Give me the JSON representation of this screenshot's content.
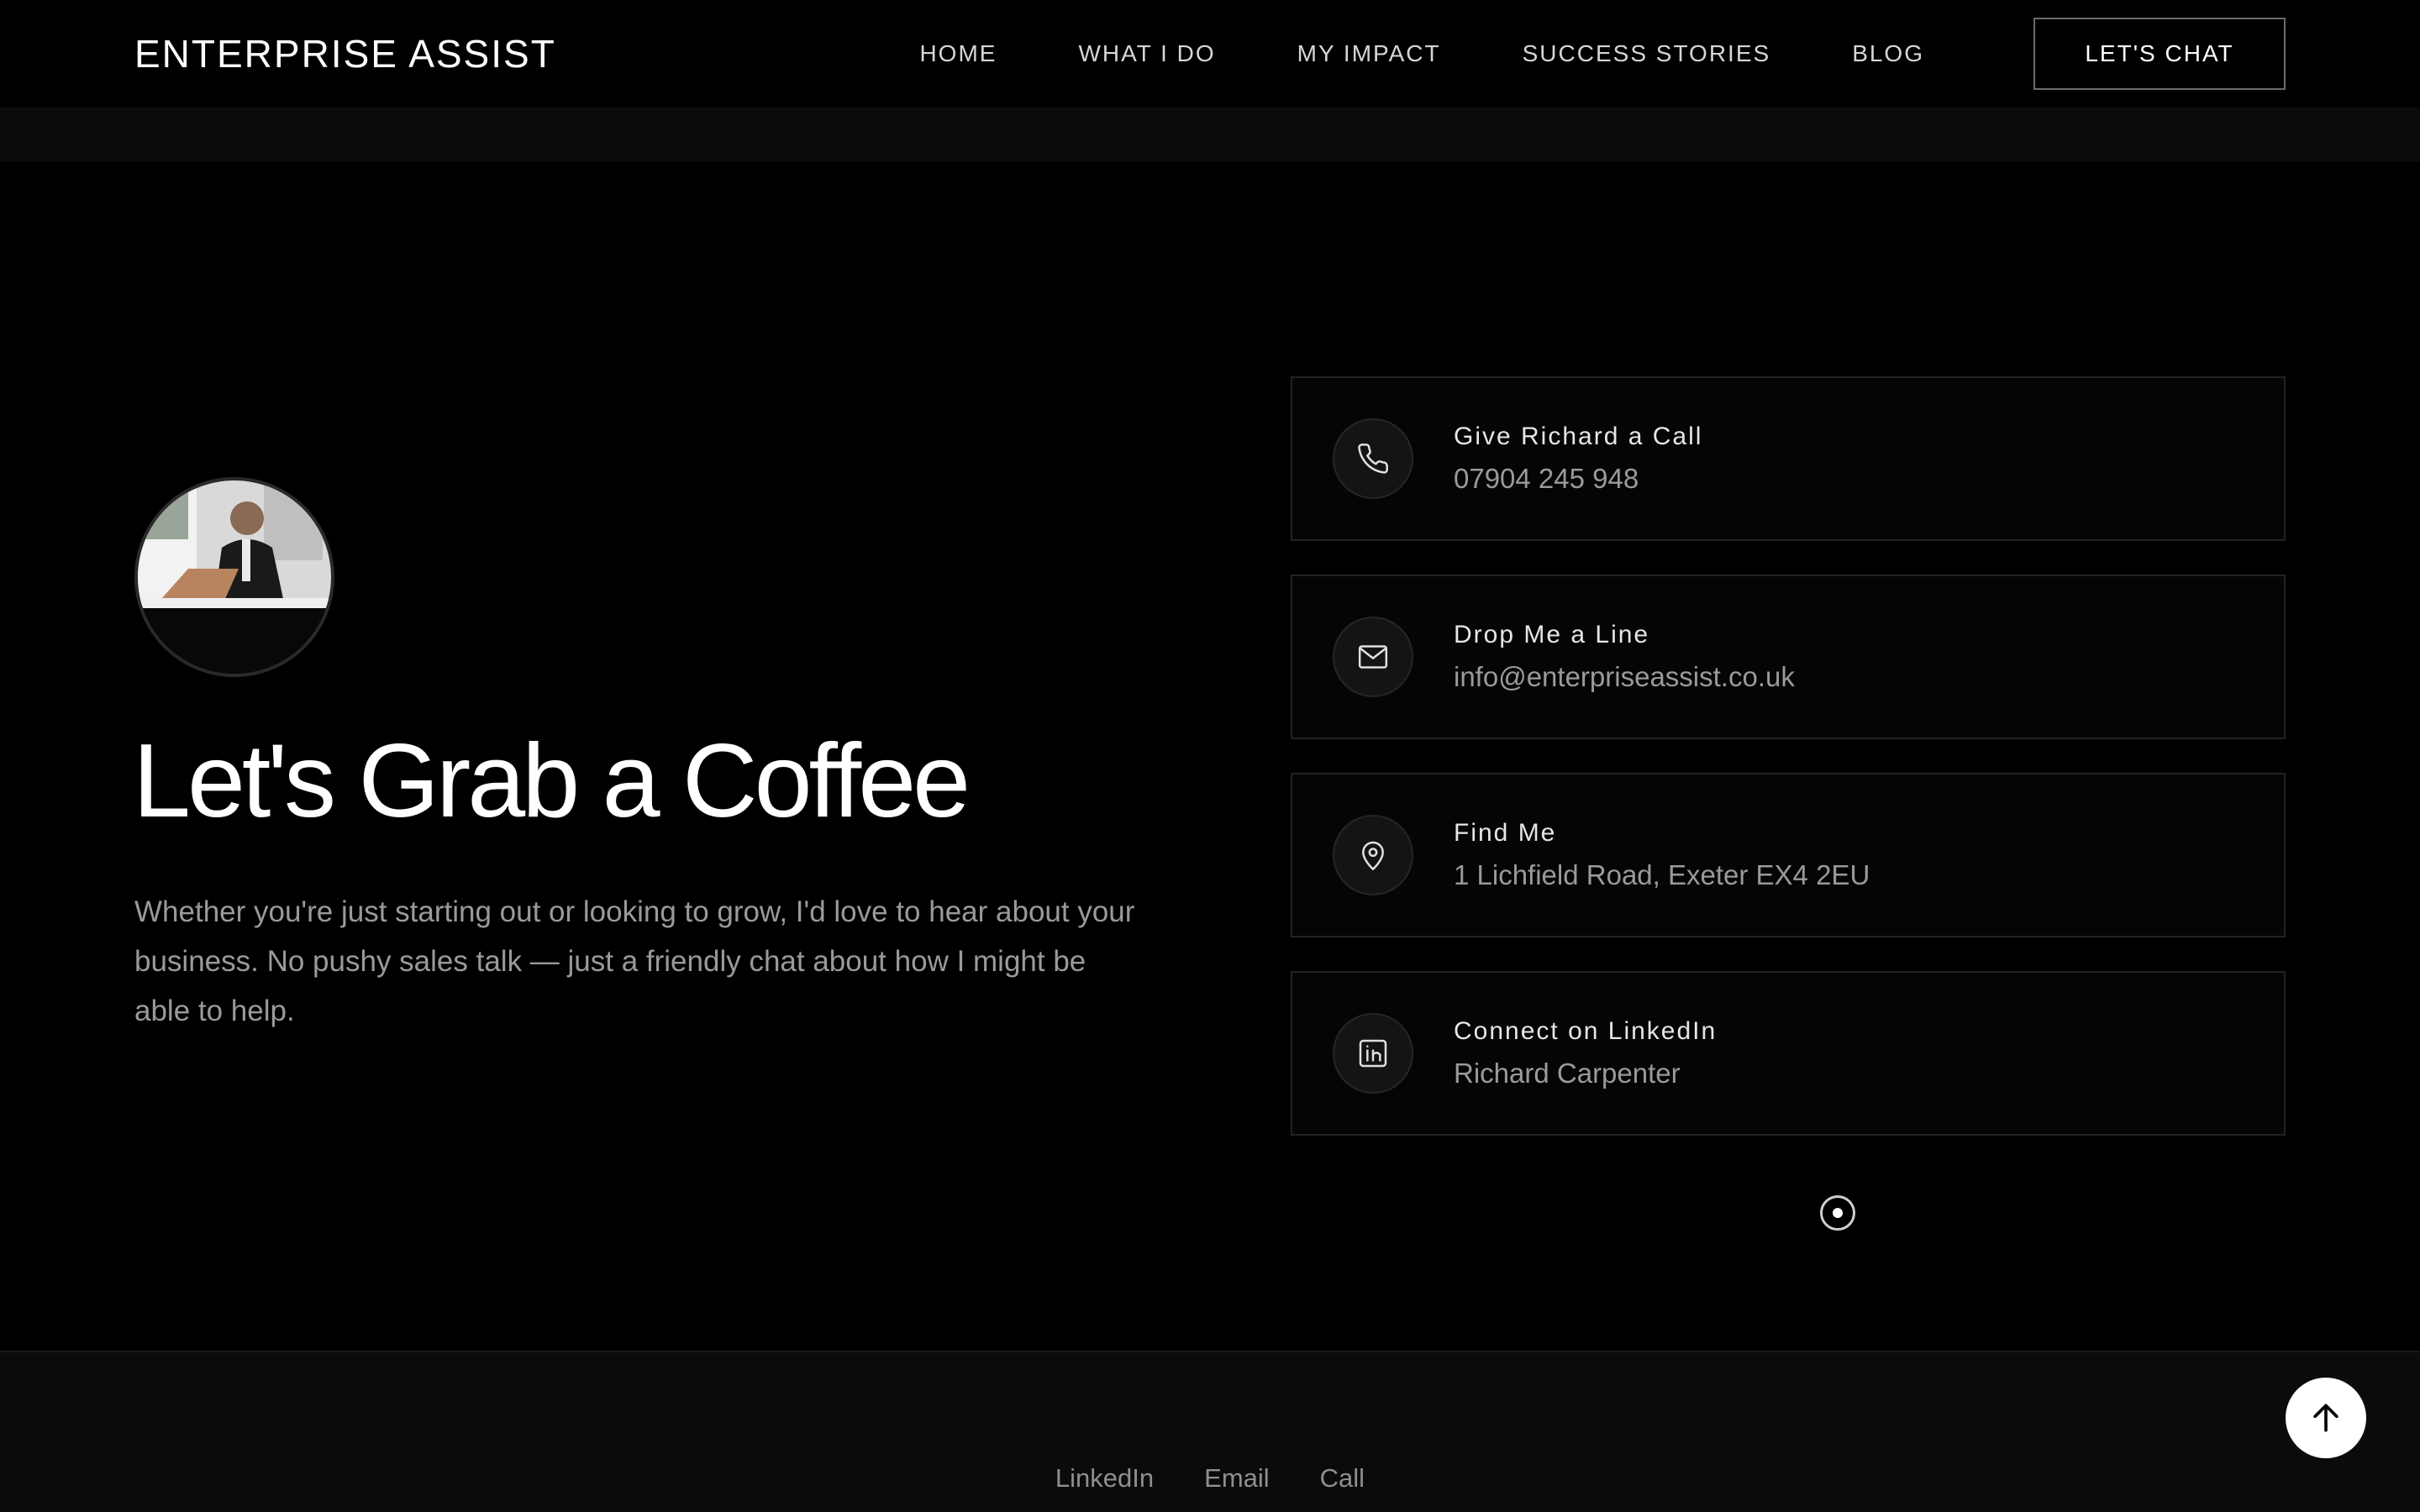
{
  "header": {
    "brand": "ENTERPRISE ASSIST",
    "nav": [
      {
        "label": "HOME"
      },
      {
        "label": "WHAT I DO"
      },
      {
        "label": "MY IMPACT"
      },
      {
        "label": "SUCCESS STORIES"
      },
      {
        "label": "BLOG"
      }
    ],
    "cta_label": "LET'S CHAT"
  },
  "hero": {
    "headline": "Let's Grab a Coffee",
    "intro": "Whether you're just starting out or looking to grow, I'd love to hear about your business. No pushy sales talk — just a friendly chat about how I might be able to help."
  },
  "contact_cards": [
    {
      "icon": "phone-icon",
      "title": "Give Richard a Call",
      "value": "07904 245 948"
    },
    {
      "icon": "mail-icon",
      "title": "Drop Me a Line",
      "value": "info@enterpriseassist.co.uk"
    },
    {
      "icon": "location-pin-icon",
      "title": "Find Me",
      "value": "1 Lichfield Road, Exeter EX4 2EU"
    },
    {
      "icon": "linkedin-icon",
      "title": "Connect on LinkedIn",
      "value": "Richard Carpenter"
    }
  ],
  "footer": {
    "links": [
      {
        "label": "LinkedIn"
      },
      {
        "label": "Email"
      },
      {
        "label": "Call"
      }
    ]
  },
  "colors": {
    "background": "#000000",
    "footer_background": "#0b0b0b",
    "card_border": "#222222",
    "muted_text": "#9a9a9a"
  }
}
